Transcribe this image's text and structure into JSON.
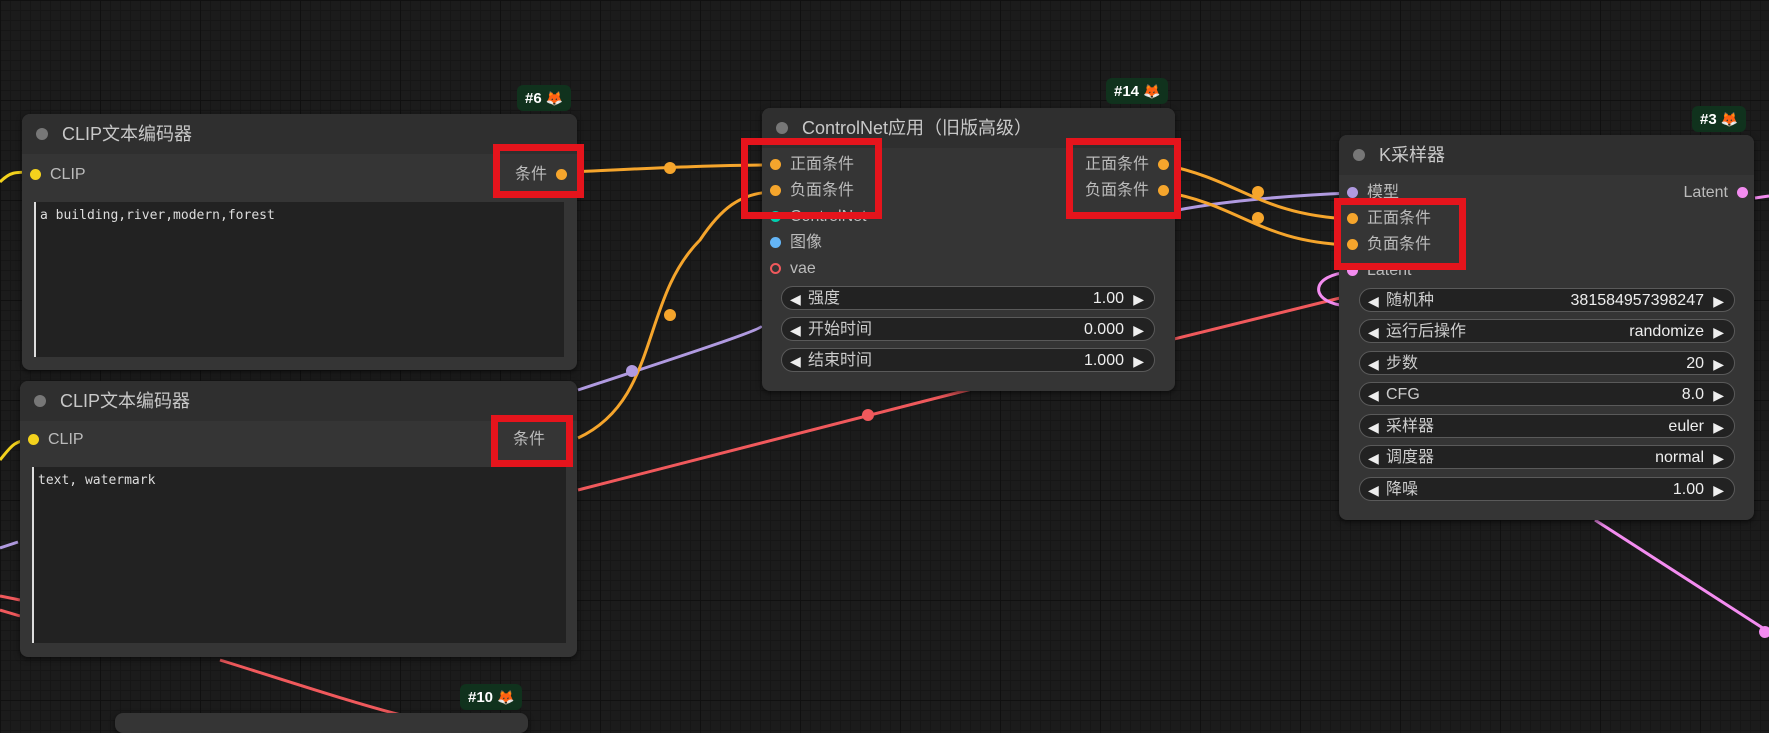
{
  "nodes": {
    "clip1": {
      "badge": "#6",
      "title": "CLIP文本编码器",
      "input_label": "CLIP",
      "output_label": "条件",
      "text": "a building,river,modern,forest"
    },
    "clip2": {
      "title": "CLIP文本编码器",
      "input_label": "CLIP",
      "output_label": "条件",
      "text": "text, watermark"
    },
    "controlnet": {
      "badge": "#14",
      "title": "ControlNet应用（旧版高级）",
      "inputs": [
        "正面条件",
        "负面条件",
        "ControlNet",
        "图像",
        "vae"
      ],
      "outputs": [
        "正面条件",
        "负面条件"
      ],
      "widgets": [
        {
          "label": "强度",
          "value": "1.00"
        },
        {
          "label": "开始时间",
          "value": "0.000"
        },
        {
          "label": "结束时间",
          "value": "1.000"
        }
      ]
    },
    "ksampler": {
      "badge": "#3",
      "title": "K采样器",
      "inputs": [
        "模型",
        "正面条件",
        "负面条件",
        "Latent"
      ],
      "output_label": "Latent",
      "widgets": [
        {
          "label": "随机种",
          "value": "381584957398247"
        },
        {
          "label": "运行后操作",
          "value": "randomize"
        },
        {
          "label": "步数",
          "value": "20"
        },
        {
          "label": "CFG",
          "value": "8.0"
        },
        {
          "label": "采样器",
          "value": "euler"
        },
        {
          "label": "调度器",
          "value": "normal"
        },
        {
          "label": "降噪",
          "value": "1.00"
        }
      ]
    },
    "node10": {
      "badge": "#10"
    }
  },
  "colors": {
    "conditioning": "#f5a52c",
    "clip": "#f3d21d",
    "vae": "#f0595c",
    "model": "#b09ae0",
    "latent": "#f38cf0",
    "image": "#64b5f6",
    "controlnet": "#00d0b0",
    "highlight": "#e5141c",
    "badge_bg": "#10321d"
  },
  "icons": {
    "badge_icon": "fox-icon",
    "arrow_left": "◀",
    "arrow_right": "▶"
  }
}
